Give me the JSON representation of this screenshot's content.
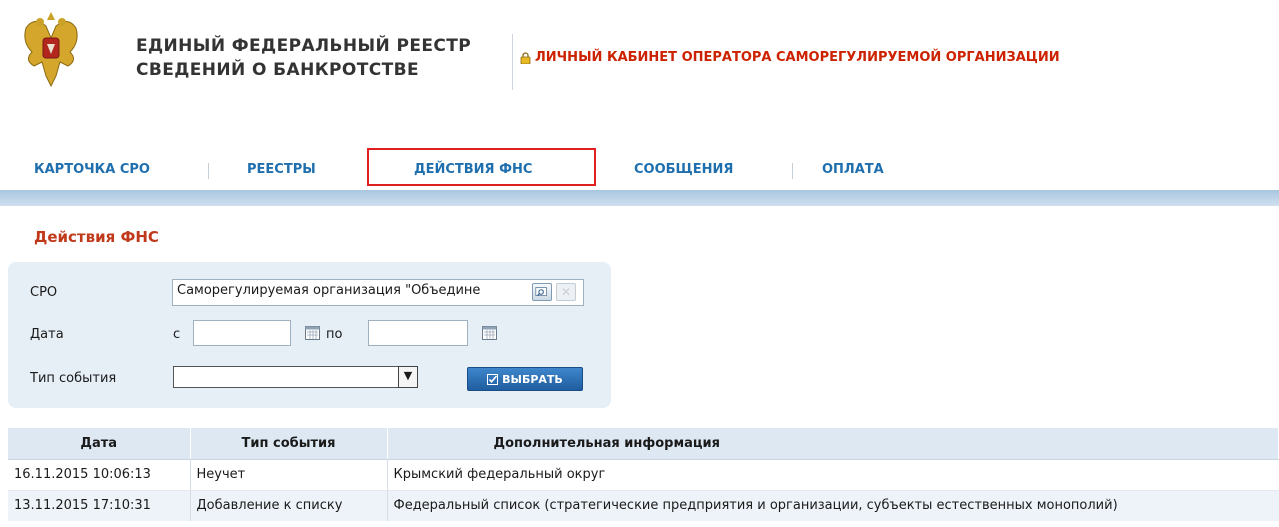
{
  "header": {
    "title_line1": "ЕДИНЫЙ ФЕДЕРАЛЬНЫЙ РЕЕСТР",
    "title_line2": "СВЕДЕНИЙ О БАНКРОТСТВЕ",
    "cabinet_label": "ЛИЧНЫЙ КАБИНЕТ ОПЕРАТОРА САМОРЕГУЛИРУЕМОЙ ОРГАНИЗАЦИИ",
    "emblem_icon": "russian-coat-of-arms",
    "lock_icon": "lock-icon"
  },
  "nav": {
    "items": [
      {
        "label": "КАРТОЧКА СРО"
      },
      {
        "label": "РЕЕСТРЫ"
      },
      {
        "label": "ДЕЙСТВИЯ ФНС",
        "active": true
      },
      {
        "label": "СООБЩЕНИЯ"
      },
      {
        "label": "ОПЛАТА"
      }
    ]
  },
  "page": {
    "title": "Действия ФНС"
  },
  "filter": {
    "sro_label": "СРО",
    "sro_value": "Саморегулируемая организация \"Объедине",
    "date_label": "Дата",
    "date_from_label": "с",
    "date_from_value": "",
    "date_to_label": "по",
    "date_to_value": "",
    "event_type_label": "Тип события",
    "event_type_value": "",
    "submit_label": "ВЫБРАТЬ"
  },
  "table": {
    "headers": [
      "Дата",
      "Тип события",
      "Дополнительная информация"
    ],
    "rows": [
      [
        "16.11.2015 10:06:13",
        "Неучет",
        "Крымский федеральный округ"
      ],
      [
        "13.11.2015 17:10:31",
        "Добавление к списку",
        "Федеральный список (стратегические предприятия и организации, субъекты естественных монополий)"
      ]
    ]
  },
  "colors": {
    "nav_link": "#1f6fae",
    "accent_red": "#c0391a",
    "cabinet_red": "#cc2200",
    "highlight_border": "#e02020",
    "filter_bg": "#e6eef6",
    "button_blue": "#2a6db3"
  }
}
